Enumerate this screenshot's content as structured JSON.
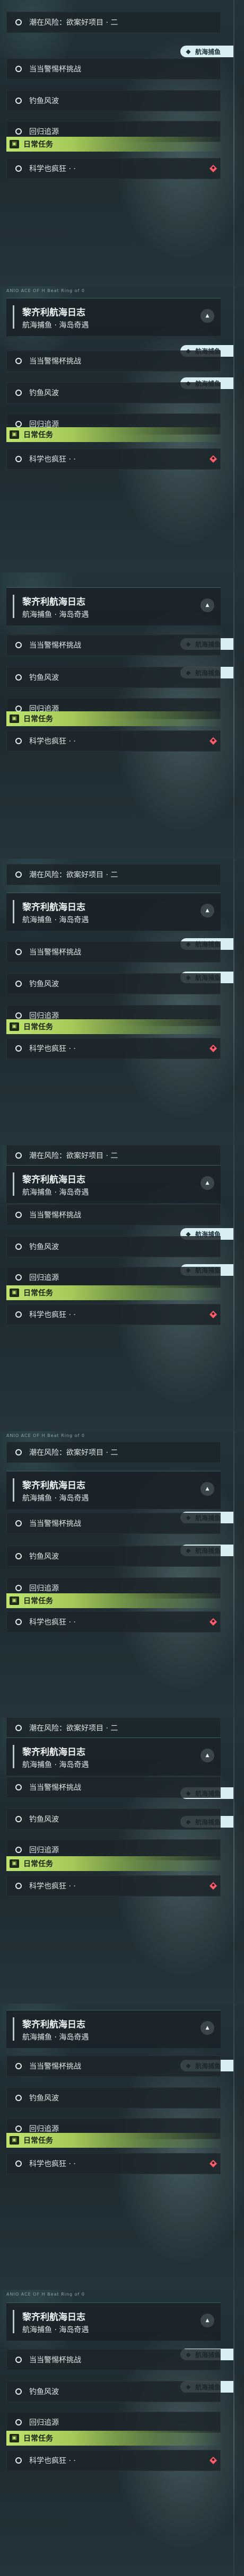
{
  "quest_group": {
    "title": "黎齐利航海日志",
    "subtitle": "航海捕鱼 · 海岛奇遇",
    "collapse_icon": "chevron-up-icon"
  },
  "quests": {
    "weird_rumor": "潮在风险：欲案好项目 · 二",
    "pirate_challenge": "当当警惕杯挑战",
    "fishing_storm": "钓鱼风波",
    "return_trace": "回归追源",
    "science_madness": "科学也疯狂 · ·"
  },
  "daily": {
    "label": "日常任务",
    "icon": "daily-task-icon"
  },
  "tag": {
    "label": "航海捕鱼",
    "icon": "map-marker-icon"
  },
  "top_caption": "ANIO ACE OF H       Beat Ring of 0",
  "colors": {
    "accent_green": "#bfe36f",
    "marker_red": "#ff5c6c",
    "tag_bg": "#d8eef3"
  }
}
